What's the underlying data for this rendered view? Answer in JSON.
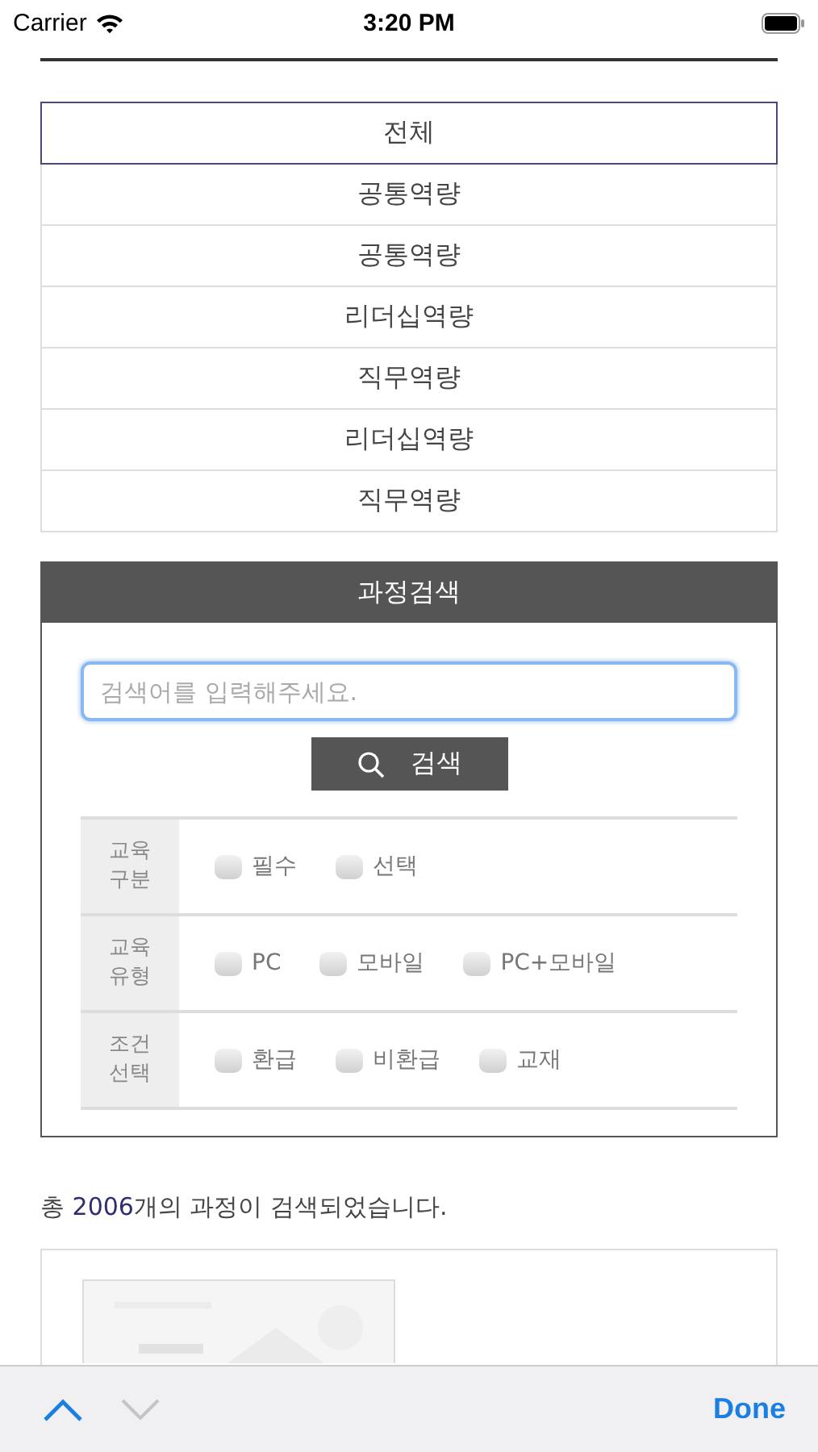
{
  "status_bar": {
    "carrier": "Carrier",
    "time": "3:20 PM"
  },
  "categories": [
    {
      "label": "전체",
      "selected": true
    },
    {
      "label": "공통역량",
      "selected": false
    },
    {
      "label": "공통역량",
      "selected": false
    },
    {
      "label": "리더십역량",
      "selected": false
    },
    {
      "label": "직무역량",
      "selected": false
    },
    {
      "label": "리더십역량",
      "selected": false
    },
    {
      "label": "직무역량",
      "selected": false
    }
  ],
  "search_panel": {
    "title": "과정검색",
    "search_field": {
      "placeholder": "검색어를 입력해주세요."
    },
    "search_button": "검색",
    "filters": [
      {
        "label": "교육\n구분",
        "options": [
          {
            "label": "필수",
            "checked": false
          },
          {
            "label": "선택",
            "checked": false
          }
        ]
      },
      {
        "label": "교육\n유형",
        "options": [
          {
            "label": "PC",
            "checked": false
          },
          {
            "label": "모바일",
            "checked": false
          },
          {
            "label": "PC+모바일",
            "checked": false
          }
        ]
      },
      {
        "label": "조건\n선택",
        "options": [
          {
            "label": "환급",
            "checked": false
          },
          {
            "label": "비환급",
            "checked": false
          },
          {
            "label": "교재",
            "checked": false
          }
        ]
      }
    ]
  },
  "result": {
    "prefix": "총 ",
    "count": "2006",
    "suffix": "개의 과정이 검색되었습니다."
  },
  "toolbar": {
    "done": "Done"
  }
}
